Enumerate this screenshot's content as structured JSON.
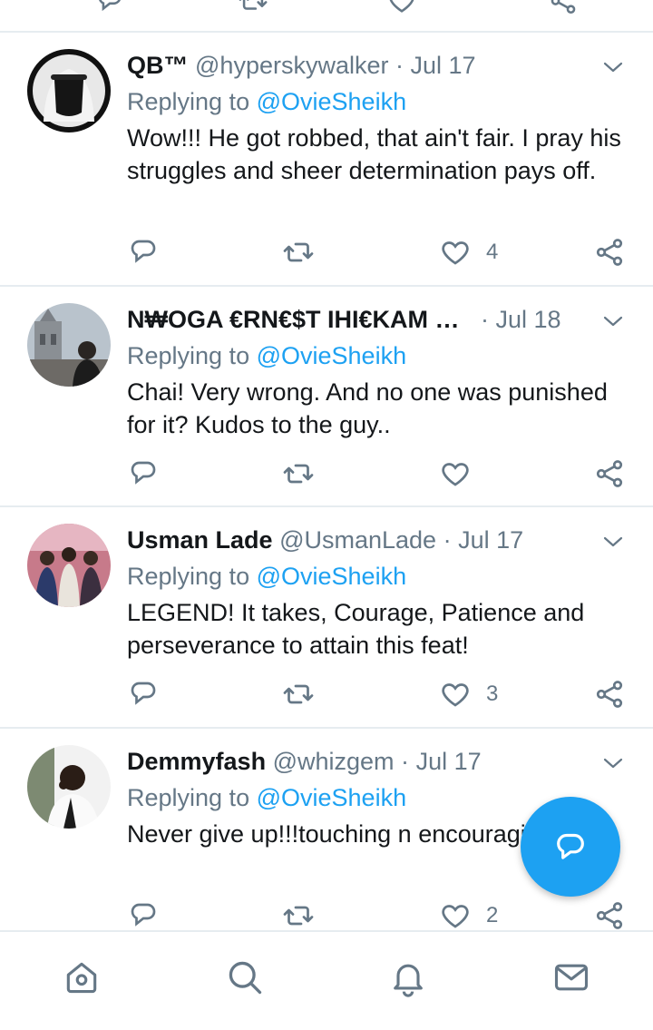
{
  "colors": {
    "accent": "#1da1f2",
    "muted": "#657786",
    "text": "#14171a",
    "divider": "#e6ecf0"
  },
  "tweets": [
    {
      "name": "QB™",
      "handle": "@hyperskywalker",
      "sep": "·",
      "date": "Jul 17",
      "replying_label": "Replying to",
      "replying_to": "@OvieSheikh",
      "text": "Wow!!! He got robbed, that ain't fair. I pray his struggles and sheer determination pays off.",
      "likes": "4",
      "avatar": "avatar-white-keffiyeh"
    },
    {
      "name": "N₩OGA €RN€$T IHI€KAM …",
      "handle": "",
      "sep": "·",
      "date": "Jul 18",
      "replying_label": "Replying to",
      "replying_to": "@OvieSheikh",
      "text": "Chai! Very wrong. And no one was punished for it? Kudos to the guy..",
      "likes": "",
      "avatar": "avatar-cathedral"
    },
    {
      "name": "Usman Lade",
      "handle": "@UsmanLade",
      "sep": "·",
      "date": "Jul 17",
      "replying_label": "Replying to",
      "replying_to": "@OvieSheikh",
      "text": "LEGEND! It takes, Courage, Patience and perseverance to attain this feat!",
      "likes": "3",
      "avatar": "avatar-group-photo"
    },
    {
      "name": "Demmyfash",
      "handle": "@whizgem",
      "sep": "·",
      "date": "Jul 17",
      "replying_label": "Replying to",
      "replying_to": "@OvieSheikh",
      "text": "Never give up!!!touching n encouraging story.",
      "likes": "2",
      "avatar": "avatar-portrait"
    }
  ],
  "icons": {
    "reply": "reply-icon",
    "retweet": "retweet-icon",
    "like": "heart-icon",
    "share": "share-icon",
    "more": "chevron-down-icon",
    "compose": "compose-reply-icon"
  },
  "nav": [
    "home-icon",
    "search-icon",
    "notifications-icon",
    "messages-icon"
  ]
}
